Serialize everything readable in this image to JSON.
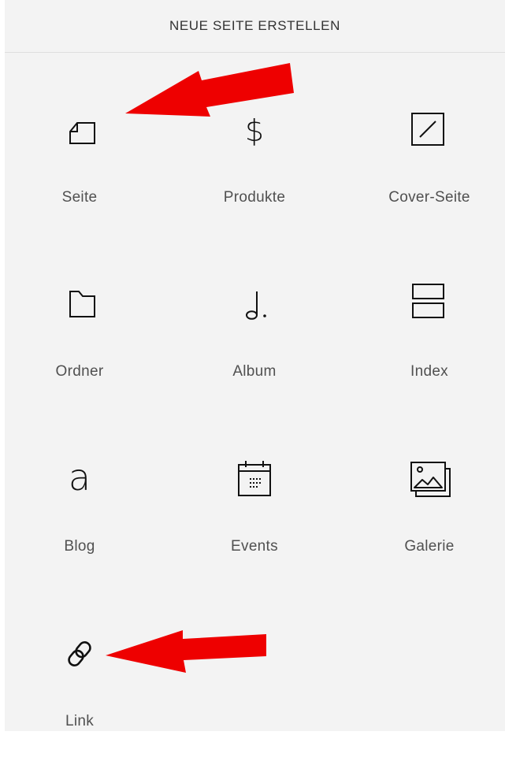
{
  "header": {
    "title": "NEUE SEITE ERSTELLEN"
  },
  "tiles": [
    {
      "label": "Seite",
      "icon": "page-icon"
    },
    {
      "label": "Produkte",
      "icon": "dollar-icon"
    },
    {
      "label": "Cover-Seite",
      "icon": "cover-page-icon"
    },
    {
      "label": "Ordner",
      "icon": "folder-icon"
    },
    {
      "label": "Album",
      "icon": "music-note-icon"
    },
    {
      "label": "Index",
      "icon": "index-icon"
    },
    {
      "label": "Blog",
      "icon": "blog-icon"
    },
    {
      "label": "Events",
      "icon": "calendar-icon"
    },
    {
      "label": "Galerie",
      "icon": "gallery-icon"
    },
    {
      "label": "Link",
      "icon": "link-icon"
    }
  ],
  "annotations": {
    "arrow_color": "#ee0000"
  },
  "colors": {
    "panel_background": "#f3f3f3",
    "icon_stroke": "#111111",
    "label_text": "#505050"
  }
}
